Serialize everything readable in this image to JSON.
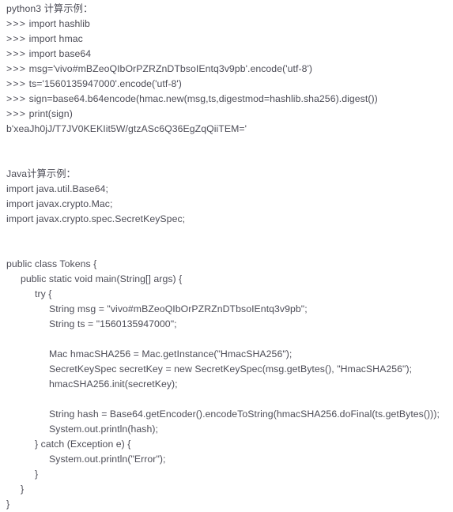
{
  "document": {
    "text_color": "#4d4d57",
    "background_color": "#ffffff",
    "sections": [
      {
        "id": "python-section",
        "heading": "python3 计算示例：",
        "lines": [
          {
            "indent": 0,
            "text": "python3 计算示例："
          },
          {
            "indent": 0,
            "text": ">>> import hashlib"
          },
          {
            "indent": 0,
            "text": ">>> import hmac"
          },
          {
            "indent": 0,
            "text": ">>> import base64"
          },
          {
            "indent": 0,
            "text": ">>> msg='vivo#mBZeoQIbOrPZRZnDTbsoIEntq3v9pb'.encode('utf-8')"
          },
          {
            "indent": 0,
            "text": ">>> ts='1560135947000'.encode('utf-8')"
          },
          {
            "indent": 0,
            "text": ">>> sign=base64.b64encode(hmac.new(msg,ts,digestmod=hashlib.sha256).digest())"
          },
          {
            "indent": 0,
            "text": ">>> print(sign)"
          },
          {
            "indent": 0,
            "text": "b'xeaJh0jJ/T7JV0KEKIit5W/gtzASc6Q36EgZqQiiTEM='"
          },
          {
            "indent": 0,
            "text": ""
          },
          {
            "indent": 0,
            "text": ""
          }
        ]
      },
      {
        "id": "java-section",
        "heading": "Java计算示例：",
        "lines": [
          {
            "indent": 0,
            "text": "Java计算示例："
          },
          {
            "indent": 0,
            "text": "import java.util.Base64;"
          },
          {
            "indent": 0,
            "text": "import javax.crypto.Mac;"
          },
          {
            "indent": 0,
            "text": "import javax.crypto.spec.SecretKeySpec;"
          },
          {
            "indent": 0,
            "text": ""
          },
          {
            "indent": 0,
            "text": ""
          },
          {
            "indent": 0,
            "text": "public class Tokens {"
          },
          {
            "indent": 1,
            "text": "public static void main(String[] args) {"
          },
          {
            "indent": 2,
            "text": "try {"
          },
          {
            "indent": 3,
            "text": "String msg = \"vivo#mBZeoQIbOrPZRZnDTbsoIEntq3v9pb\";"
          },
          {
            "indent": 3,
            "text": "String ts = \"1560135947000\";"
          },
          {
            "indent": 0,
            "text": ""
          },
          {
            "indent": 3,
            "text": "Mac hmacSHA256 = Mac.getInstance(\"HmacSHA256\");"
          },
          {
            "indent": 3,
            "text": "SecretKeySpec secretKey = new SecretKeySpec(msg.getBytes(), \"HmacSHA256\");"
          },
          {
            "indent": 3,
            "text": "hmacSHA256.init(secretKey);"
          },
          {
            "indent": 0,
            "text": ""
          },
          {
            "indent": 3,
            "text": "String hash = Base64.getEncoder().encodeToString(hmacSHA256.doFinal(ts.getBytes()));"
          },
          {
            "indent": 3,
            "text": "System.out.println(hash);"
          },
          {
            "indent": 2,
            "text": "} catch (Exception e) {"
          },
          {
            "indent": 3,
            "text": "System.out.println(\"Error\");"
          },
          {
            "indent": 2,
            "text": "}"
          },
          {
            "indent": 1,
            "text": "}"
          },
          {
            "indent": 0,
            "text": "}"
          }
        ]
      }
    ]
  }
}
